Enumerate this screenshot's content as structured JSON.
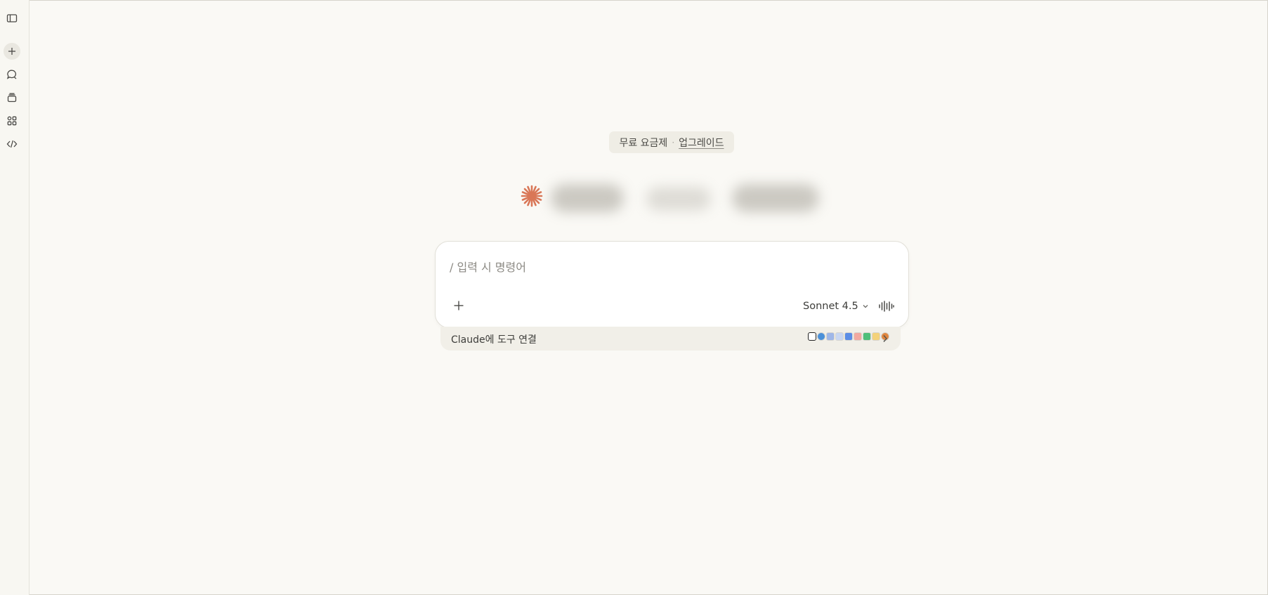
{
  "plan_badge": {
    "plan_label": "무료 요금제",
    "separator": "·",
    "upgrade_label": "업그레이드"
  },
  "composer": {
    "placeholder": "/ 입력 시 명령어",
    "model_label": "Sonnet 4.5"
  },
  "connect_tools": {
    "label": "Claude에 도구 연결",
    "integrations": [
      "notion-icon",
      "chrome-icon",
      "drive-icon",
      "docs-icon",
      "drive-triangle-icon",
      "asana-icon",
      "google-calendar-icon",
      "gmail-icon",
      "slack-icon"
    ]
  },
  "sidebar": {
    "items": [
      "sidebar-toggle-icon",
      "new-chat-icon",
      "chats-icon",
      "projects-icon",
      "artifacts-icon",
      "code-icon"
    ]
  },
  "colors": {
    "background": "#faf9f5",
    "accent": "#d97757"
  }
}
